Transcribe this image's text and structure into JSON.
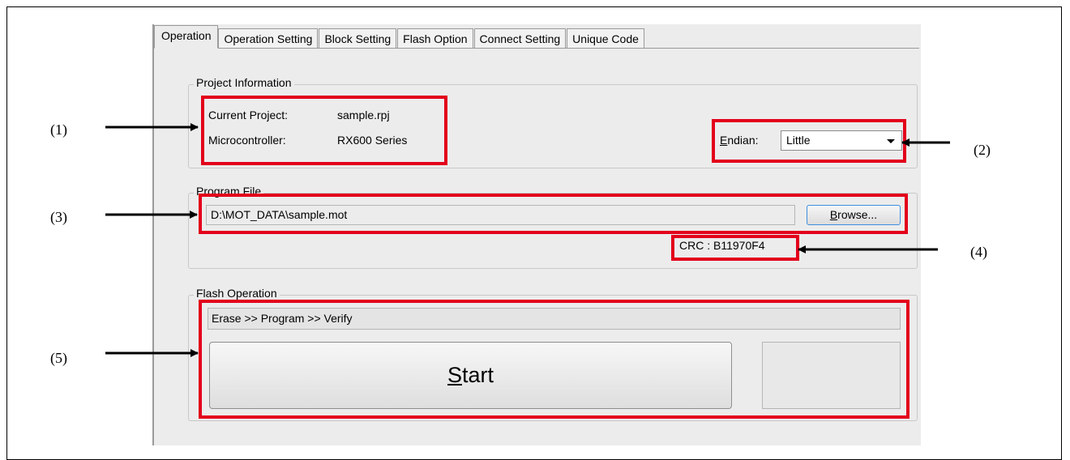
{
  "tabs": [
    "Operation",
    "Operation Setting",
    "Block Setting",
    "Flash Option",
    "Connect Setting",
    "Unique Code"
  ],
  "project_info": {
    "title": "Project Information",
    "current_project_label": "Current Project:",
    "current_project_value": "sample.rpj",
    "microcontroller_label": "Microcontroller:",
    "microcontroller_value": "RX600 Series",
    "endian_label": "Endian:",
    "endian_mnemonic": "E",
    "endian_rest": "ndian:",
    "endian_value": "Little"
  },
  "program_file": {
    "title": "Program File",
    "path": "D:\\MOT_DATA\\sample.mot",
    "browse_mnemonic": "B",
    "browse_rest": "rowse...",
    "crc": "CRC : B11970F4"
  },
  "flash_operation": {
    "title": "Flash Operation",
    "sequence": "Erase >> Program >> Verify",
    "start_mnemonic": "S",
    "start_rest": "tart"
  },
  "callouts": [
    "(1)",
    "(2)",
    "(3)",
    "(4)",
    "(5)"
  ],
  "colors": {
    "highlight": "#e3001b",
    "panel": "#ececec",
    "focus": "#3d8ee0"
  }
}
